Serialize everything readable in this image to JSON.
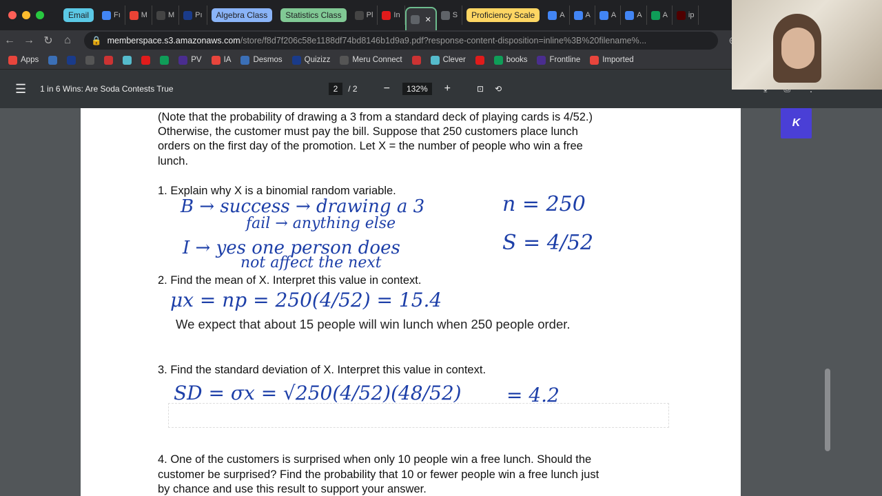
{
  "tabs": [
    {
      "type": "group",
      "label": "Email",
      "color": "#5bc9e6"
    },
    {
      "label": "Fı",
      "icon": "google-docs"
    },
    {
      "label": "M",
      "icon": "gmail"
    },
    {
      "label": "M",
      "icon": "schoology"
    },
    {
      "label": "Pı",
      "icon": "sis"
    },
    {
      "type": "group",
      "label": "Algebra Class",
      "color": "#8ab4f8"
    },
    {
      "type": "group",
      "label": "Statistics Class",
      "color": "#81c995"
    },
    {
      "label": "Pl",
      "icon": "schoology"
    },
    {
      "label": "In",
      "icon": "red-cross"
    },
    {
      "label": "",
      "icon": "globe",
      "active": true
    },
    {
      "label": "S",
      "icon": "globe"
    },
    {
      "type": "group",
      "label": "Proficiency Scale",
      "color": "#fdd663"
    },
    {
      "label": "A",
      "icon": "google-docs"
    },
    {
      "label": "A",
      "icon": "google-docs"
    },
    {
      "label": "A",
      "icon": "google-docs"
    },
    {
      "label": "A",
      "icon": "google-docs"
    },
    {
      "label": "A",
      "icon": "google-sheets"
    },
    {
      "label": "ip",
      "icon": "tamu"
    }
  ],
  "address": {
    "host": "memberspace.s3.amazonaws.com",
    "path": "/store/f8d7f206c58e1188df74bd8146b1d9a9.pdf?response-content-disposition=inline%3B%20filename%..."
  },
  "bookmarks": [
    "Apps",
    "",
    "",
    "",
    "",
    "",
    "",
    "",
    "PV",
    "IA",
    "Desmos",
    "Quizizz",
    "Meru Connect",
    "",
    "Clever",
    "",
    "books",
    "Frontline",
    "Imported"
  ],
  "pdf": {
    "title": "1 in 6 Wins: Are Soda Contests True",
    "page_current": "2",
    "page_total": "/ 2",
    "zoom": "132%"
  },
  "content": {
    "l1": "(Note that the probability of drawing a 3 from a standard deck of playing cards is 4/52.)",
    "l2": "Otherwise, the customer must pay the bill. Suppose that 250 customers place lunch",
    "l3": "orders on the first day of the promotion. Let X = the number of people who win a free",
    "l4": "lunch.",
    "q1": "1. Explain why X is a binomial random variable.",
    "q2": "2. Find the mean of X. Interpret this value in context.",
    "a2": "We expect that about 15 people will win lunch when 250 people order.",
    "q3": "3. Find the standard deviation of X. Interpret this value in context.",
    "q4a": "4. One of the customers is surprised when only 10 people win a free lunch. Should the",
    "q4b": "customer be surprised? Find the probability that 10 or fewer people win a free lunch just",
    "q4c": "by chance and use this result to support your answer."
  },
  "handwriting": {
    "b1": "B → success → drawing a 3",
    "b2": "fail → anything else",
    "i1": "I → yes one person does",
    "i2": "not affect the next",
    "n": "n = 250",
    "s": "S = 4/52",
    "mean": "μx = np = 250(4/52) = 15.4",
    "sd": "SD = σx = √250(4/52)(48/52)",
    "sdval": "= 4.2"
  },
  "kami_button": "K"
}
